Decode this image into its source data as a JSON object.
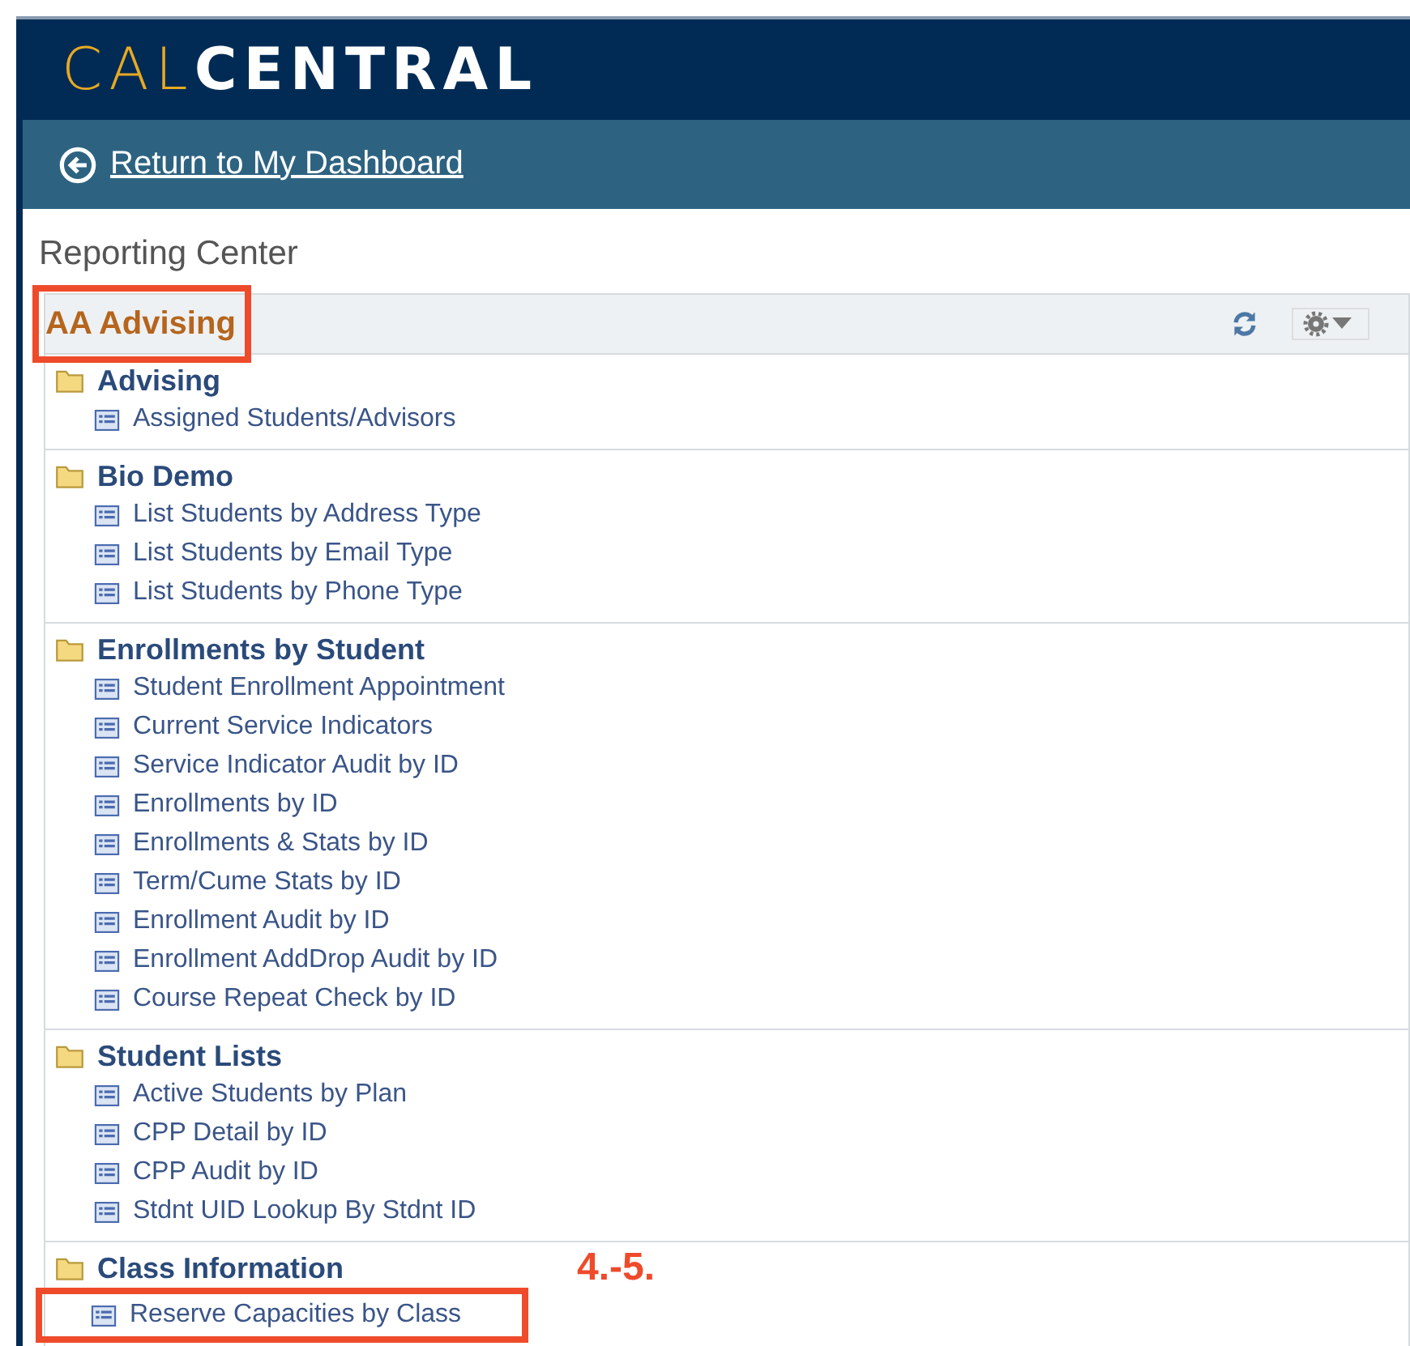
{
  "header": {
    "logo_part_1": "CAL",
    "logo_part_2": "CENTRAL"
  },
  "nav_bar": {
    "link": "Return to My Dashboard"
  },
  "page_title": "Reporting Center",
  "panel": {
    "title": "AA Advising",
    "title_highlighted": true,
    "groups": [
      {
        "name": "Advising",
        "items": [
          {
            "label": "Assigned Students/Advisors",
            "highlighted": false
          }
        ]
      },
      {
        "name": "Bio Demo",
        "items": [
          {
            "label": "List Students by Address Type",
            "highlighted": false
          },
          {
            "label": "List Students by Email Type",
            "highlighted": false
          },
          {
            "label": "List Students by Phone Type",
            "highlighted": false
          }
        ]
      },
      {
        "name": "Enrollments by Student",
        "items": [
          {
            "label": "Student Enrollment Appointment",
            "highlighted": false
          },
          {
            "label": "Current Service Indicators",
            "highlighted": false
          },
          {
            "label": "Service Indicator Audit by ID",
            "highlighted": false
          },
          {
            "label": "Enrollments by ID",
            "highlighted": false
          },
          {
            "label": "Enrollments & Stats by ID",
            "highlighted": false
          },
          {
            "label": "Term/Cume Stats by ID",
            "highlighted": false
          },
          {
            "label": "Enrollment Audit by ID",
            "highlighted": false
          },
          {
            "label": "Enrollment AddDrop Audit by ID",
            "highlighted": false
          },
          {
            "label": "Course Repeat Check by ID",
            "highlighted": false
          }
        ]
      },
      {
        "name": "Student Lists",
        "items": [
          {
            "label": "Active Students by Plan",
            "highlighted": false
          },
          {
            "label": "CPP Detail by ID",
            "highlighted": false
          },
          {
            "label": "CPP Audit by ID",
            "highlighted": false
          },
          {
            "label": "Stdnt UID Lookup By Stdnt ID",
            "highlighted": false
          }
        ]
      },
      {
        "name": "Class Information",
        "items": [
          {
            "label": "Reserve Capacities by Class",
            "highlighted": true
          }
        ]
      }
    ]
  },
  "annotation": "4.-5."
}
